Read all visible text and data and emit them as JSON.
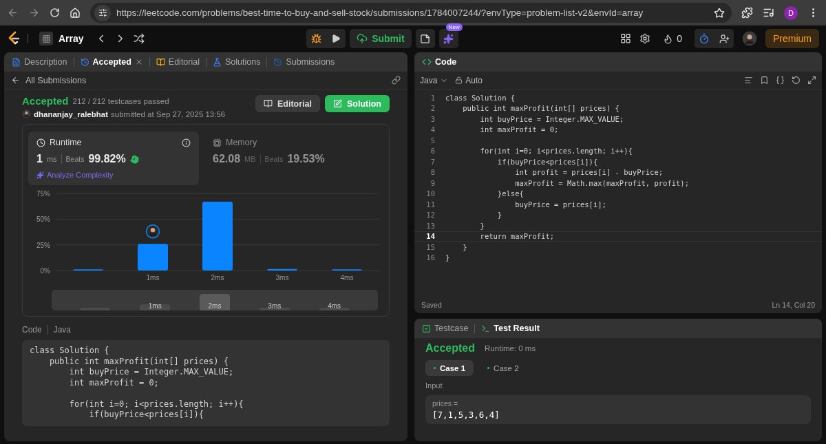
{
  "browser": {
    "url": "https://leetcode.com/problems/best-time-to-buy-and-sell-stock/submissions/1784007244/?envType=problem-list-v2&envId=array",
    "profile": "D"
  },
  "header": {
    "problem_list": "Array",
    "submit": "Submit",
    "new_badge": "New",
    "streak": "0",
    "premium": "Premium"
  },
  "left_tabs": [
    {
      "label": "Description",
      "kind": "description",
      "selected": false
    },
    {
      "label": "Accepted",
      "kind": "result",
      "selected": true
    },
    {
      "label": "Editorial",
      "kind": "editorial",
      "selected": false
    },
    {
      "label": "Solutions",
      "kind": "solutions",
      "selected": false
    },
    {
      "label": "Submissions",
      "kind": "submissions",
      "selected": false
    }
  ],
  "submission": {
    "back": "All Submissions",
    "status": "Accepted",
    "testcases": "212 / 212 testcases passed",
    "user": "dhananjay_ralebhat",
    "submitted": "submitted at Sep 27, 2025 13:56",
    "editorial_button": "Editorial",
    "solution_button": "Solution"
  },
  "metrics": [
    {
      "kind": "runtime",
      "title": "Runtime",
      "value": "1",
      "unit": "ms",
      "beats_label": "Beats",
      "beats": "99.82%",
      "analyze": "Analyze Complexity",
      "selected": true
    },
    {
      "kind": "memory",
      "title": "Memory",
      "value": "62.08",
      "unit": "MB",
      "beats_label": "Beats",
      "beats": "19.53%",
      "selected": false
    }
  ],
  "chart_data": {
    "type": "bar",
    "categories": [
      null,
      "1ms",
      "2ms",
      "3ms",
      "4ms"
    ],
    "series": [
      {
        "color": "#0a84ff",
        "values": [
          1.2,
          26,
          67,
          1.5,
          1.2
        ]
      }
    ],
    "ylim": [
      0,
      75
    ],
    "yticks": [
      {
        "value": 0,
        "label": "0%"
      },
      {
        "value": 25,
        "label": "25%"
      },
      {
        "value": 50,
        "label": "50%"
      },
      {
        "value": 75,
        "label": "75%"
      }
    ],
    "annotations": [
      {
        "x": "1ms"
      }
    ]
  },
  "overview_labels": [
    "1ms",
    "2ms",
    "3ms",
    "4ms"
  ],
  "code_section": {
    "label": "Code",
    "language": "Java",
    "code": "class Solution {\n    public int maxProfit(int[] prices) {\n        int buyPrice = Integer.MAX_VALUE;\n        int maxProfit = 0;\n\n        for(int i=0; i<prices.length; i++){\n            if(buyPrice<prices[i]){"
  },
  "editor": {
    "title": "Code",
    "language": "Java",
    "mode": "Auto",
    "lines": [
      {
        "number": "1",
        "text": "class Solution {",
        "selected": false
      },
      {
        "number": "2",
        "text": "    public int maxProfit(int[] prices) {",
        "selected": false
      },
      {
        "number": "3",
        "text": "        int buyPrice = Integer.MAX_VALUE;",
        "selected": false
      },
      {
        "number": "4",
        "text": "        int maxProfit = 0;",
        "selected": false
      },
      {
        "number": "5",
        "selected": false
      },
      {
        "number": "6",
        "text": "        for(int i=0; i<prices.length; i++){",
        "selected": false
      },
      {
        "number": "7",
        "text": "            if(buyPrice<prices[i]){",
        "selected": false
      },
      {
        "number": "8",
        "text": "                int profit = prices[i] - buyPrice;",
        "selected": false
      },
      {
        "number": "9",
        "text": "                maxProfit = Math.max(maxProfit, profit);",
        "selected": false
      },
      {
        "number": "10",
        "text": "            }else{",
        "selected": false
      },
      {
        "number": "11",
        "text": "                buyPrice = prices[i];",
        "selected": false
      },
      {
        "number": "12",
        "text": "            }",
        "selected": false
      },
      {
        "number": "13",
        "text": "        }",
        "selected": false
      },
      {
        "number": "14",
        "text": "        return maxProfit;",
        "selected": true
      },
      {
        "number": "15",
        "text": "    }",
        "selected": false
      },
      {
        "number": "16",
        "text": "}",
        "selected": false
      }
    ],
    "status": "Saved",
    "cursor": "Ln 14, Col 20"
  },
  "bottom": {
    "tabs": [
      {
        "label": "Testcase",
        "kind": "testcase",
        "selected": false
      },
      {
        "label": "Test Result",
        "kind": "result",
        "selected": true
      }
    ],
    "status": "Accepted",
    "runtime": "Runtime: 0 ms",
    "cases": [
      {
        "label": "Case 1",
        "selected": true
      },
      {
        "label": "Case 2",
        "selected": false
      }
    ],
    "input_label": "Input",
    "param_name": "prices =",
    "param_value": "[7,1,5,3,6,4]"
  }
}
